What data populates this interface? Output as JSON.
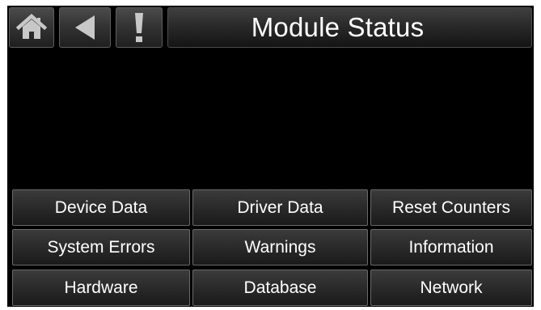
{
  "header": {
    "title": "Module Status",
    "home_icon": "home-icon",
    "back_icon": "back-arrow-icon",
    "alert_icon": "exclamation-icon"
  },
  "buttons": {
    "device_data": "Device Data",
    "driver_data": "Driver Data",
    "reset_counters": "Reset Counters",
    "system_errors": "System Errors",
    "warnings": "Warnings",
    "information": "Information",
    "hardware": "Hardware",
    "database": "Database",
    "network": "Network"
  },
  "colors": {
    "panel_background": "#000000",
    "button_text": "#ffffff",
    "icon_gray": "#c8c8c8"
  }
}
